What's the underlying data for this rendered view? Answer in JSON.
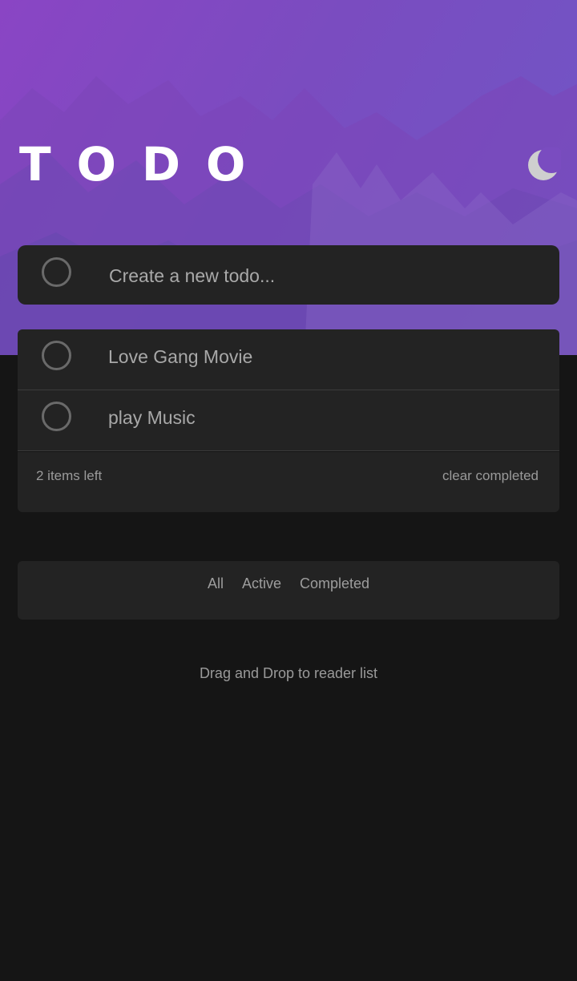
{
  "header": {
    "title": "TODO",
    "theme_toggle_icon": "moon-icon"
  },
  "new_todo": {
    "placeholder": "Create a new todo...",
    "value": ""
  },
  "todos": [
    {
      "text": "Love Gang Movie",
      "completed": false
    },
    {
      "text": "play Music",
      "completed": false
    }
  ],
  "footer": {
    "items_left": "2 items left",
    "clear_completed": "clear completed"
  },
  "filters": {
    "all": "All",
    "active": "Active",
    "completed": "Completed"
  },
  "hint": "Drag and Drop to reader list",
  "colors": {
    "background": "#151515",
    "card": "#232323",
    "hero_gradient_start": "#8a45c4",
    "hero_gradient_end": "#6f57c6"
  }
}
